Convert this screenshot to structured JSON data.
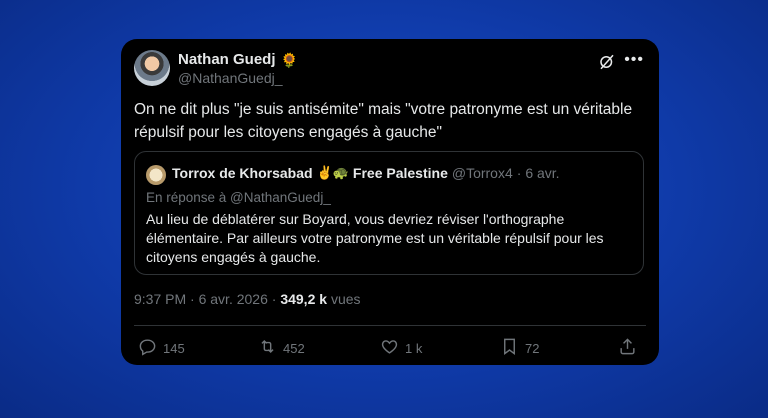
{
  "tweet": {
    "author": {
      "display_name": "Nathan Guedj",
      "emoji": "🌻",
      "handle": "@NathanGuedj_"
    },
    "text": "On ne dit plus \"je suis antisémite\" mais \"votre patronyme est un véritable répulsif pour les citoyens engagés à gauche\"",
    "time": "9:37 PM",
    "date": "6 avr. 2026",
    "views_count": "349,2 k",
    "views_label": "vues",
    "stats": {
      "replies": "145",
      "reposts": "452",
      "likes": "1 k",
      "bookmarks": "72"
    }
  },
  "quote": {
    "author": {
      "display_name": "Torrox de Khorsabad",
      "emoji": "✌️🐢",
      "suffix": "Free Palestine",
      "handle": "@Torrox4",
      "date": "· 6 avr."
    },
    "reply_to": "En réponse à @NathanGuedj_",
    "text": "Au lieu de déblatérer sur Boyard, vous devriez réviser l'orthographe élémentaire. Par ailleurs votre patronyme est un véritable répulsif pour les citoyens engagés à gauche."
  },
  "icons": {
    "grok": "grok-icon",
    "more": "more-icon",
    "reply": "reply-icon",
    "repost": "repost-icon",
    "like": "like-icon",
    "bookmark": "bookmark-icon",
    "share": "share-icon"
  },
  "colors": {
    "background": "#0f3aa8",
    "card": "#000000",
    "text": "#e7e9ea",
    "muted": "#71767b",
    "border": "#2f3336"
  }
}
